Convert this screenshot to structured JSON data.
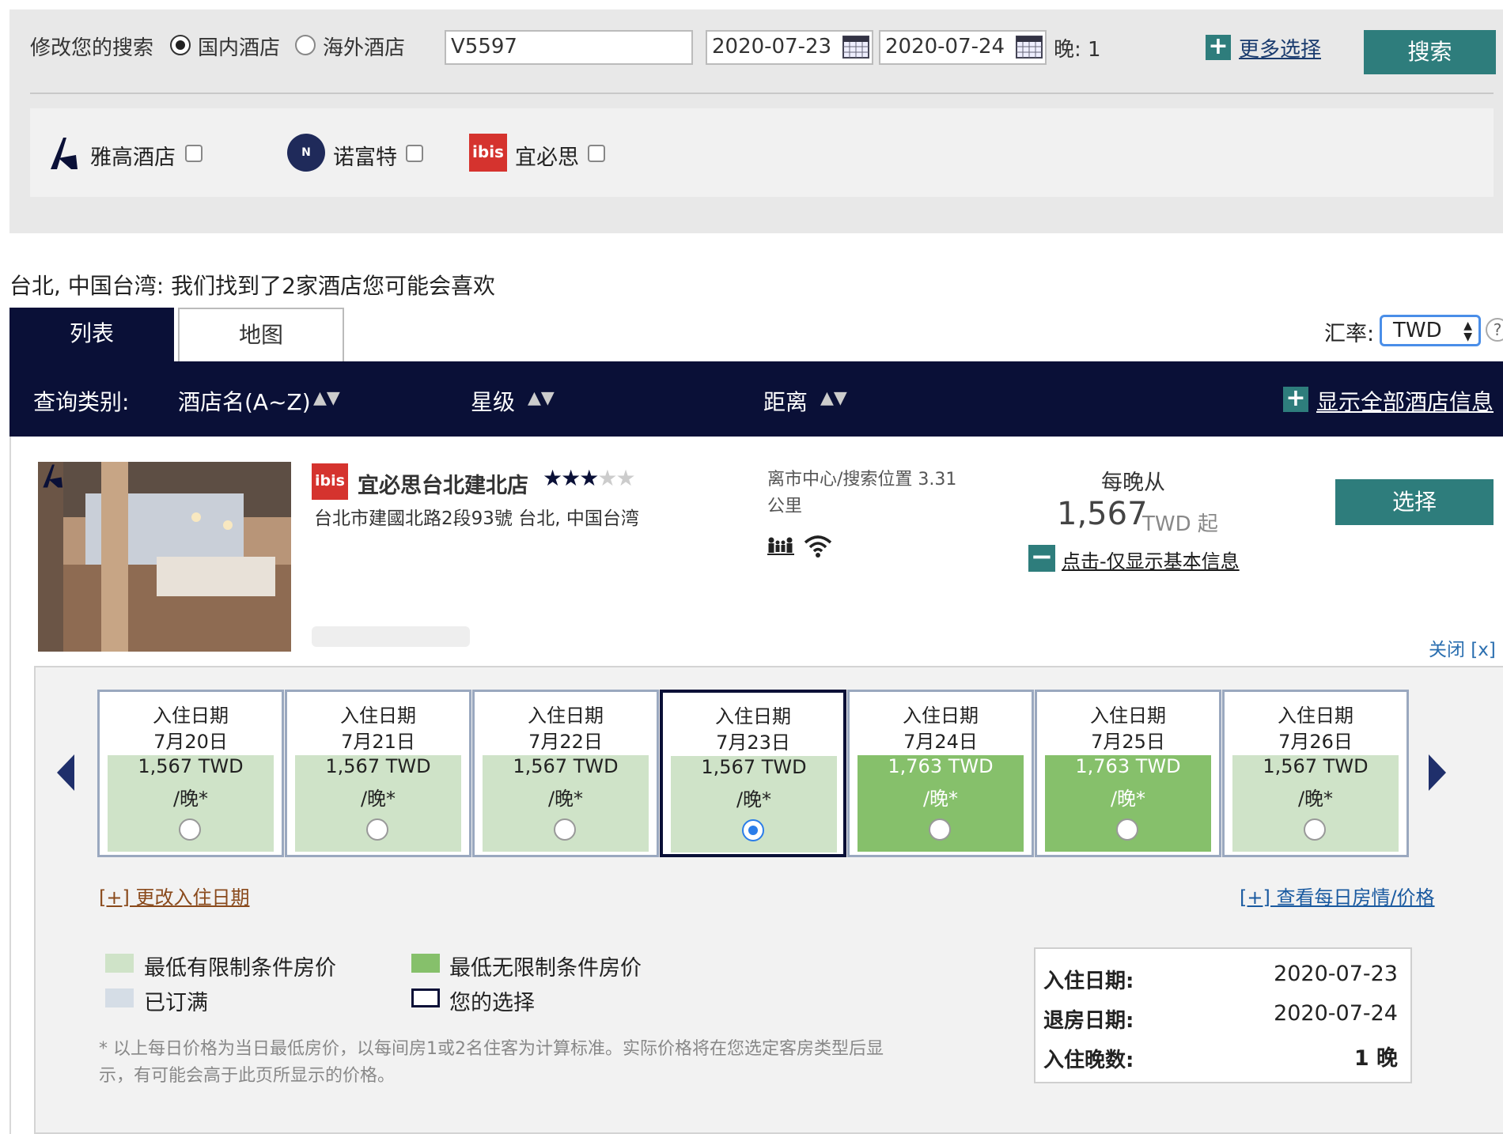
{
  "search": {
    "modify_label": "修改您的搜索",
    "radio_domestic": "国内酒店",
    "radio_overseas": "海外酒店",
    "keyword": "V5597",
    "checkin": "2020-07-23",
    "checkout": "2020-07-24",
    "nights_label": "晚: 1",
    "more_options": "更多选择",
    "search_button": "搜索"
  },
  "brands": [
    {
      "name": "雅高酒店"
    },
    {
      "name": "诺富特",
      "logo_text": "N"
    },
    {
      "name": "宜必思",
      "logo_text": "ibis"
    }
  ],
  "results": {
    "title": "台北, 中国台湾: 我们找到了2家酒店您可能会喜欢",
    "tab_list": "列表",
    "tab_map": "地图",
    "currency_label": "汇率:",
    "currency_value": "TWD",
    "help": "?"
  },
  "sort_bar": {
    "label": "查询类别:",
    "by_name": "酒店名(A~Z)",
    "by_stars": "星级",
    "by_distance": "距离",
    "arrows": "▲▼",
    "show_all": "显示全部酒店信息"
  },
  "hotel": {
    "brand_logo_text": "ibis",
    "name": "宜必思台北建北店",
    "stars": 3,
    "max_stars": 5,
    "address": "台北市建國北路2段93號 台北, 中国台湾",
    "distance_line1": "离市中心/搜索位置 3.31",
    "distance_line2": "公里",
    "price_from_label": "每晚从",
    "price": "1,567",
    "price_unit": "TWD 起",
    "basic_info_link": "点击-仅显示基本信息",
    "select_button": "选择",
    "close_link": "关闭 [x]"
  },
  "calendar": {
    "days": [
      {
        "label": "入住日期",
        "date": "7月20日",
        "price": "1,567 TWD",
        "per": "/晚*",
        "type": "restricted",
        "selected": false
      },
      {
        "label": "入住日期",
        "date": "7月21日",
        "price": "1,567 TWD",
        "per": "/晚*",
        "type": "restricted",
        "selected": false
      },
      {
        "label": "入住日期",
        "date": "7月22日",
        "price": "1,567 TWD",
        "per": "/晚*",
        "type": "restricted",
        "selected": false
      },
      {
        "label": "入住日期",
        "date": "7月23日",
        "price": "1,567 TWD",
        "per": "/晚*",
        "type": "restricted",
        "selected": true
      },
      {
        "label": "入住日期",
        "date": "7月24日",
        "price": "1,763 TWD",
        "per": "/晚*",
        "type": "unrestricted",
        "selected": false
      },
      {
        "label": "入住日期",
        "date": "7月25日",
        "price": "1,763 TWD",
        "per": "/晚*",
        "type": "unrestricted",
        "selected": false
      },
      {
        "label": "入住日期",
        "date": "7月26日",
        "price": "1,567 TWD",
        "per": "/晚*",
        "type": "restricted",
        "selected": false
      }
    ],
    "change_date_link": "[+] 更改入住日期",
    "daily_rates_link": "[+] 查看每日房情/价格",
    "colors": {
      "restricted": "#cfe3c8",
      "unrestricted": "#86c06b",
      "full": "#d5dde6",
      "selected_border": "#0a1037"
    }
  },
  "legend": {
    "restricted": "最低有限制条件房价",
    "unrestricted": "最低无限制条件房价",
    "full": "已订满",
    "your_choice": "您的选择",
    "note_line1": "* 以上每日价格为当日最低房价，以每间房1或2名住客为计算标准。实际价格将在您选定客房类型后显",
    "note_line2": "示，有可能会高于此页所显示的价格。"
  },
  "summary": {
    "checkin_label": "入住日期:",
    "checkin_value": "2020-07-23",
    "checkout_label": "退房日期:",
    "checkout_value": "2020-07-24",
    "nights_label": "入住晚数:",
    "nights_value": "1 晚"
  }
}
